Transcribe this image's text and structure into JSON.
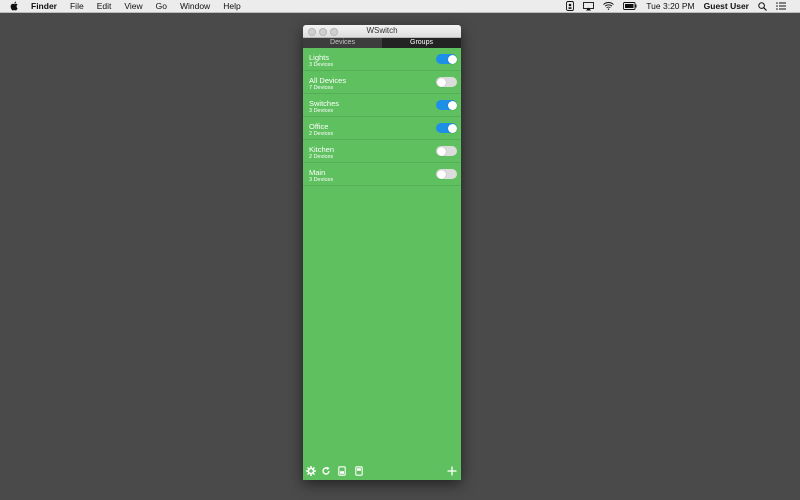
{
  "menubar": {
    "app": "Finder",
    "menus": [
      "File",
      "Edit",
      "View",
      "Go",
      "Window",
      "Help"
    ],
    "clock": "Tue 3:20 PM",
    "user": "Guest User"
  },
  "window": {
    "title": "WSwitch",
    "tabs": [
      {
        "label": "Devices",
        "selected": false
      },
      {
        "label": "Groups",
        "selected": true
      }
    ]
  },
  "groups": [
    {
      "name": "Lights",
      "count": "3 Devices",
      "on": true
    },
    {
      "name": "All Devices",
      "count": "7 Devices",
      "on": false
    },
    {
      "name": "Switches",
      "count": "3 Devices",
      "on": true
    },
    {
      "name": "Office",
      "count": "2 Devices",
      "on": true
    },
    {
      "name": "Kitchen",
      "count": "2 Devices",
      "on": false
    },
    {
      "name": "Main",
      "count": "3 Devices",
      "on": false
    }
  ],
  "toolbar_icons": [
    "gear-icon",
    "refresh-icon",
    "device-icon",
    "device-alt-icon",
    "plus-icon"
  ],
  "colors": {
    "background": "#5ec05e",
    "toggle_on": "#1e8fe6",
    "desktop": "#4a4a4a"
  }
}
